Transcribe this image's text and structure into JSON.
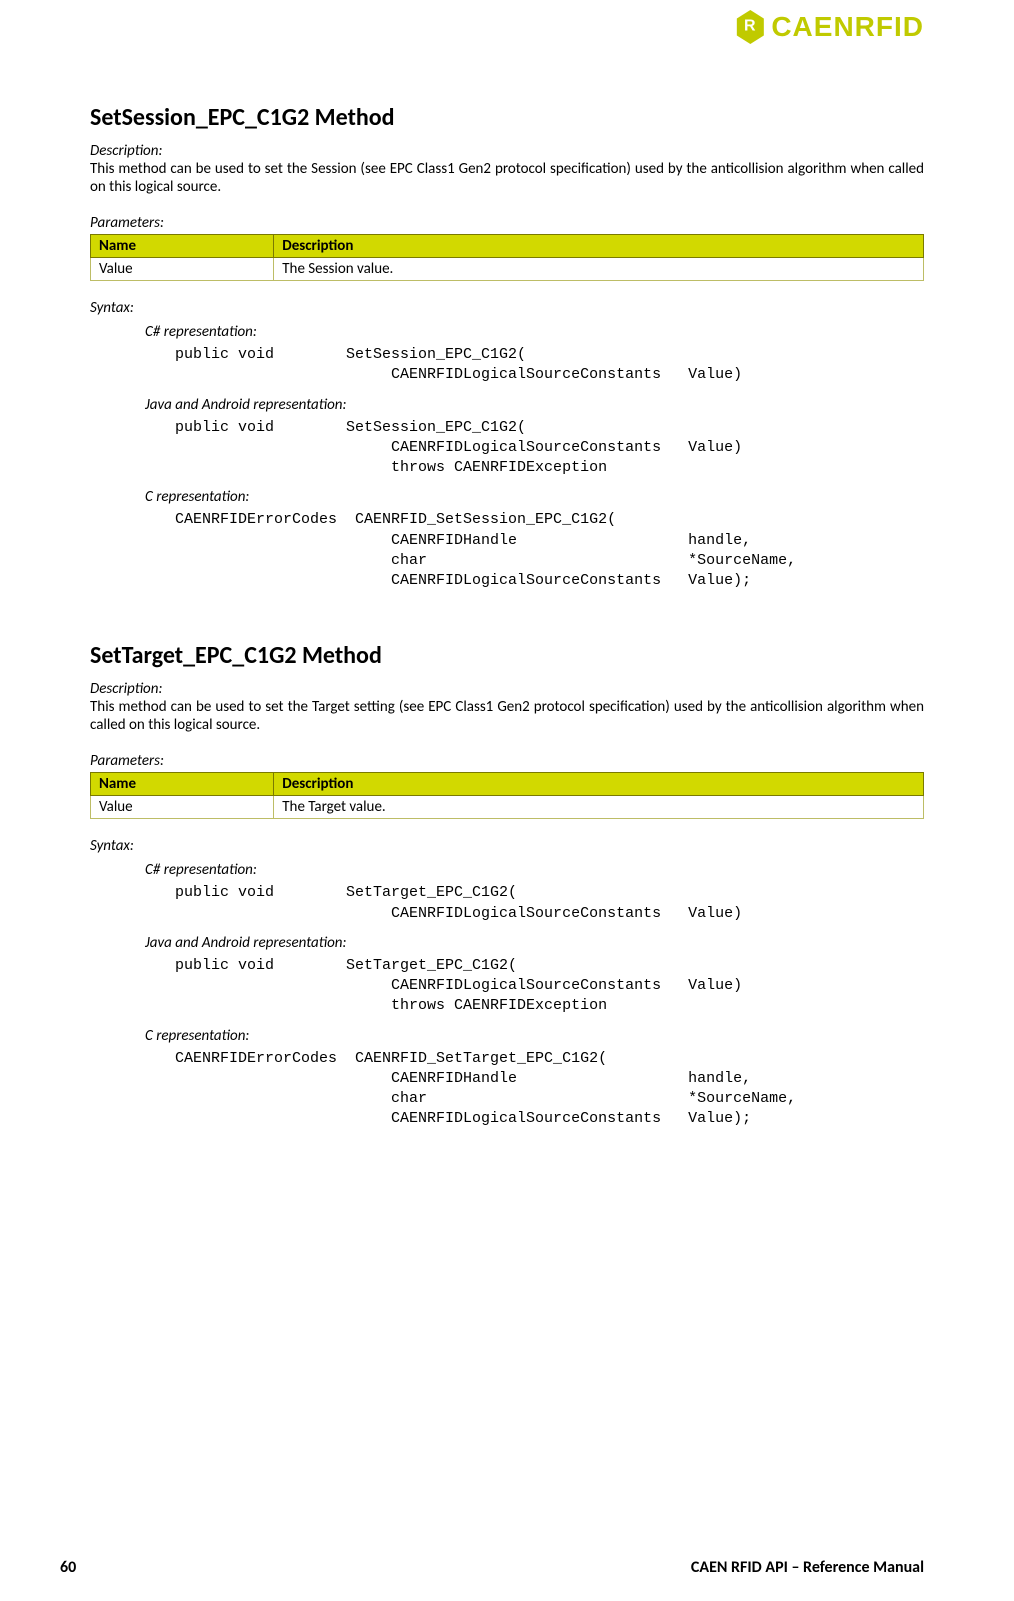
{
  "brand": "CAENRFID",
  "footer": {
    "page": "60",
    "title": "CAEN RFID API – Reference Manual"
  },
  "labels": {
    "description": "Description:",
    "parameters": "Parameters:",
    "syntax": "Syntax:",
    "col_name": "Name",
    "col_desc": "Description",
    "rep_cs": "C# representation:",
    "rep_java": "Java and Android representation:",
    "rep_c": "C representation:"
  },
  "section1": {
    "title": "SetSession_EPC_C1G2 Method",
    "desc": "This method can be used to set the Session (see EPC Class1 Gen2 protocol specification) used by the anticollision algorithm when called on this logical source.",
    "param_name": "Value",
    "param_desc": "The Session value.",
    "code_cs": "public void        SetSession_EPC_C1G2(\n                        CAENRFIDLogicalSourceConstants   Value)",
    "code_java": "public void        SetSession_EPC_C1G2(\n                        CAENRFIDLogicalSourceConstants   Value)\n                        throws CAENRFIDException",
    "code_c": "CAENRFIDErrorCodes  CAENRFID_SetSession_EPC_C1G2(\n                        CAENRFIDHandle                   handle,\n                        char                             *SourceName,\n                        CAENRFIDLogicalSourceConstants   Value);"
  },
  "section2": {
    "title": "SetTarget_EPC_C1G2 Method",
    "desc": "This method can be used to set the Target setting (see EPC Class1 Gen2 protocol specification) used by the anticollision algorithm when called on this logical source.",
    "param_name": "Value",
    "param_desc": "The Target value.",
    "code_cs": "public void        SetTarget_EPC_C1G2(\n                        CAENRFIDLogicalSourceConstants   Value)",
    "code_java": "public void        SetTarget_EPC_C1G2(\n                        CAENRFIDLogicalSourceConstants   Value)\n                        throws CAENRFIDException",
    "code_c": "CAENRFIDErrorCodes  CAENRFID_SetTarget_EPC_C1G2(\n                        CAENRFIDHandle                   handle,\n                        char                             *SourceName,\n                        CAENRFIDLogicalSourceConstants   Value);"
  }
}
